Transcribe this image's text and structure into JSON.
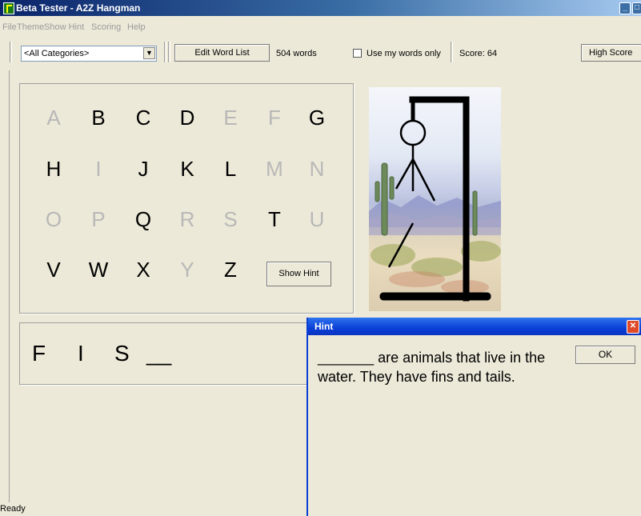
{
  "window": {
    "title": "Beta Tester - A2Z Hangman"
  },
  "menu": [
    "File",
    "Theme",
    "Show Hint",
    "Scoring",
    "Help"
  ],
  "toolbar": {
    "category": "<All Categories>",
    "edit_word_list": "Edit Word List",
    "word_count": "504 words",
    "use_my_words_only": "Use my words only",
    "use_my_words_only_checked": false,
    "score": "Score: 64",
    "high_score": "High Score"
  },
  "letters": [
    {
      "ch": "A",
      "used": true
    },
    {
      "ch": "B",
      "used": false
    },
    {
      "ch": "C",
      "used": false
    },
    {
      "ch": "D",
      "used": false
    },
    {
      "ch": "E",
      "used": true
    },
    {
      "ch": "F",
      "used": true
    },
    {
      "ch": "G",
      "used": false
    },
    {
      "ch": "H",
      "used": false
    },
    {
      "ch": "I",
      "used": true
    },
    {
      "ch": "J",
      "used": false
    },
    {
      "ch": "K",
      "used": false
    },
    {
      "ch": "L",
      "used": false
    },
    {
      "ch": "M",
      "used": true
    },
    {
      "ch": "N",
      "used": true
    },
    {
      "ch": "O",
      "used": true
    },
    {
      "ch": "P",
      "used": true
    },
    {
      "ch": "Q",
      "used": false
    },
    {
      "ch": "R",
      "used": true
    },
    {
      "ch": "S",
      "used": true
    },
    {
      "ch": "T",
      "used": false
    },
    {
      "ch": "U",
      "used": true
    },
    {
      "ch": "V",
      "used": false
    },
    {
      "ch": "W",
      "used": false
    },
    {
      "ch": "X",
      "used": false
    },
    {
      "ch": "Y",
      "used": true
    },
    {
      "ch": "Z",
      "used": false
    }
  ],
  "show_hint_button": "Show Hint",
  "word_display": [
    "F",
    "I",
    "S",
    "__"
  ],
  "status": "Ready",
  "hint_dialog": {
    "title": "Hint",
    "text": "_______ are animals that live in the water. They have fins and tails.",
    "ok": "OK"
  }
}
